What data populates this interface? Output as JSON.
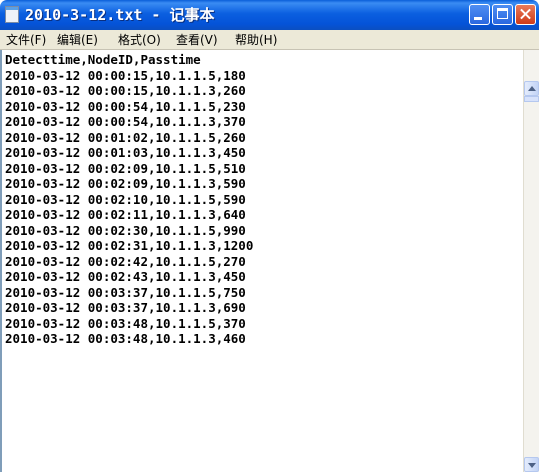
{
  "window": {
    "title": "2010-3-12.txt - 记事本"
  },
  "menu": {
    "file": "文件(F)",
    "edit": "编辑(E)",
    "format": "格式(O)",
    "view": "查看(V)",
    "help": "帮助(H)"
  },
  "document": {
    "lines": [
      "Detecttime,NodeID,Passtime",
      "2010-03-12 00:00:15,10.1.1.5,180",
      "2010-03-12 00:00:15,10.1.1.3,260",
      "2010-03-12 00:00:54,10.1.1.5,230",
      "2010-03-12 00:00:54,10.1.1.3,370",
      "2010-03-12 00:01:02,10.1.1.5,260",
      "2010-03-12 00:01:03,10.1.1.3,450",
      "2010-03-12 00:02:09,10.1.1.5,510",
      "2010-03-12 00:02:09,10.1.1.3,590",
      "2010-03-12 00:02:10,10.1.1.5,590",
      "2010-03-12 00:02:11,10.1.1.3,640",
      "2010-03-12 00:02:30,10.1.1.5,990",
      "2010-03-12 00:02:31,10.1.1.3,1200",
      "2010-03-12 00:02:42,10.1.1.5,270",
      "2010-03-12 00:02:43,10.1.1.3,450",
      "2010-03-12 00:03:37,10.1.1.5,750",
      "2010-03-12 00:03:37,10.1.1.3,690",
      "2010-03-12 00:03:48,10.1.1.5,370",
      "2010-03-12 00:03:48,10.1.1.3,460"
    ]
  }
}
